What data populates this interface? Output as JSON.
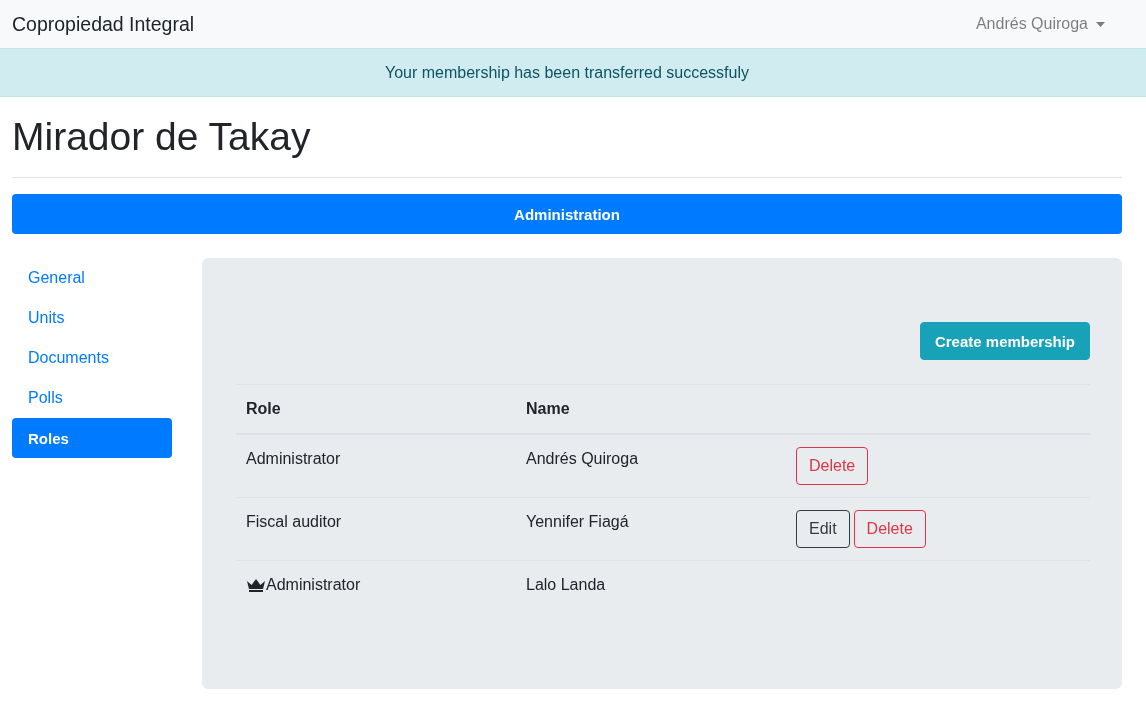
{
  "navbar": {
    "brand": "Copropiedad Integral",
    "user_menu": "Andrés Quiroga"
  },
  "alert": {
    "message": "Your membership has been transferred successfuly"
  },
  "page_title": "Mirador de Takay",
  "section_bar": {
    "label": "Administration"
  },
  "sidebar": {
    "items": [
      {
        "label": "General",
        "selected": false
      },
      {
        "label": "Units",
        "selected": false
      },
      {
        "label": "Documents",
        "selected": false
      },
      {
        "label": "Polls",
        "selected": false
      },
      {
        "label": "Roles",
        "selected": true
      }
    ]
  },
  "panel": {
    "create_button": "Create membership",
    "table": {
      "columns": [
        "Role",
        "Name"
      ],
      "rows": [
        {
          "role": "Administrator",
          "name": "Andrés Quiroga",
          "owner": false,
          "actions": [
            {
              "label": "Delete",
              "kind": "delete"
            }
          ]
        },
        {
          "role": "Fiscal auditor",
          "name": "Yennifer Fiagá",
          "owner": false,
          "actions": [
            {
              "label": "Edit",
              "kind": "edit"
            },
            {
              "label": "Delete",
              "kind": "delete"
            }
          ]
        },
        {
          "role": "Administrator",
          "name": "Lalo Landa",
          "owner": true,
          "actions": []
        }
      ]
    }
  }
}
